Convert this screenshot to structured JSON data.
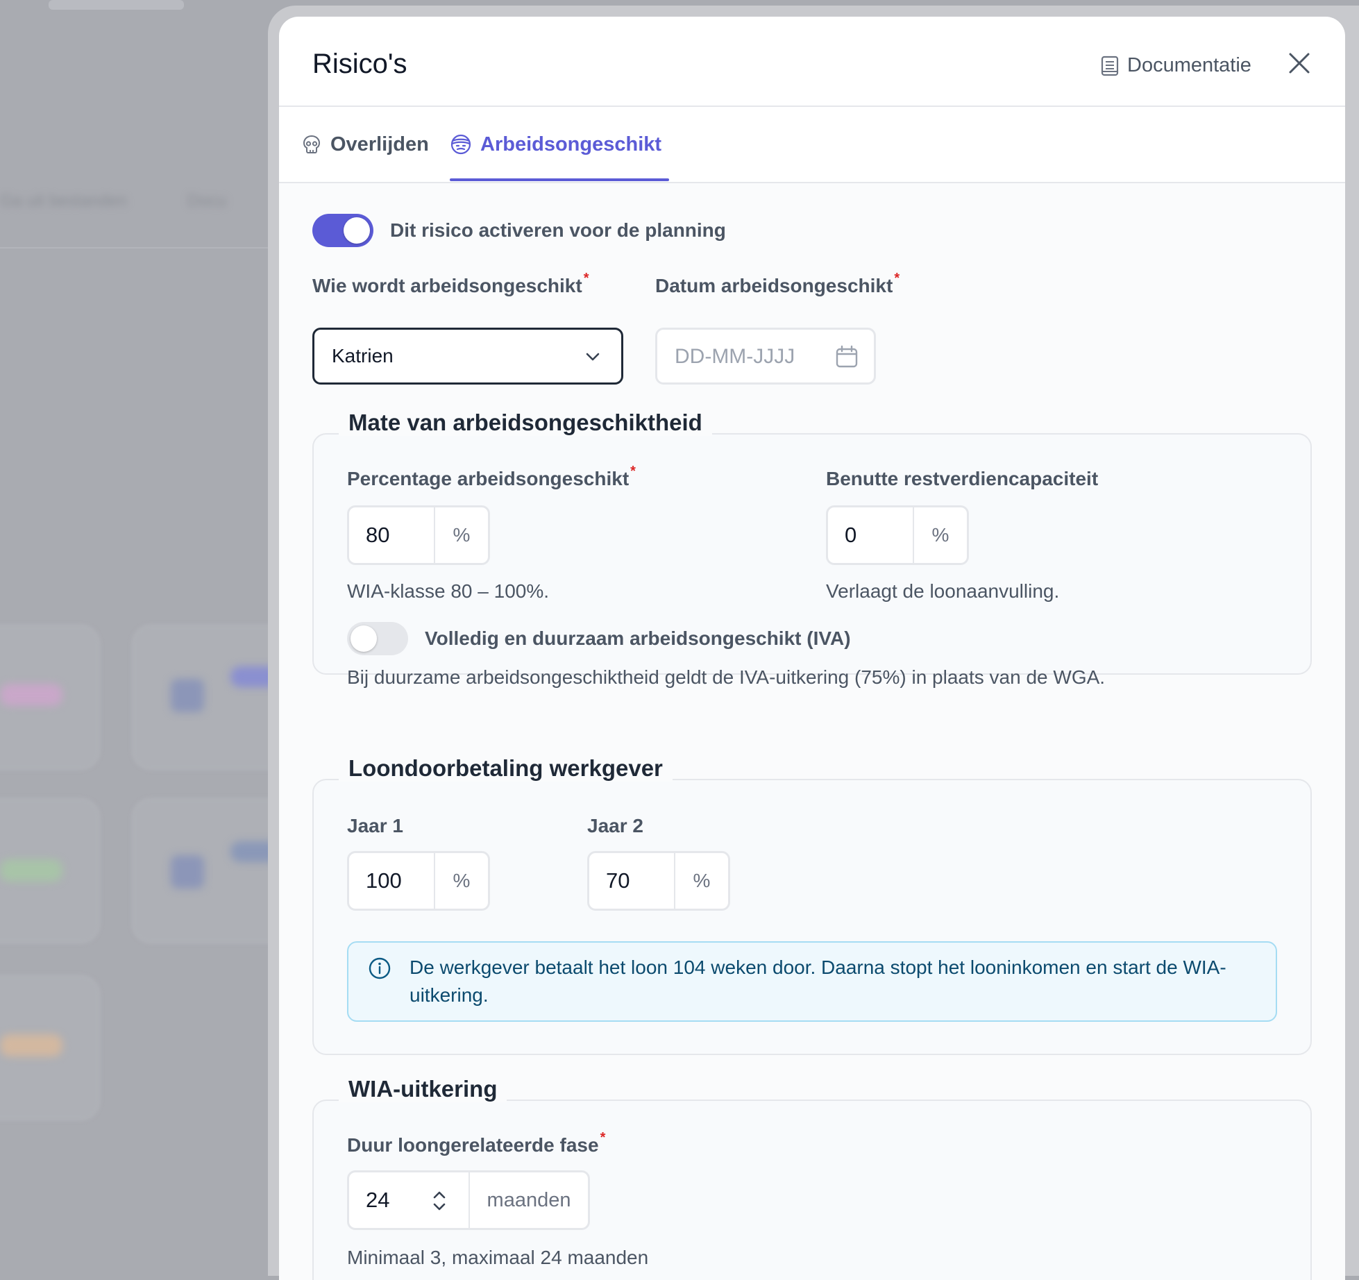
{
  "background": {
    "text_left": "Ga uit bestanden",
    "text_right": "Docu"
  },
  "modal": {
    "title": "Risico's",
    "doc_link": "Documentatie",
    "close_icon": "close-icon"
  },
  "tabs": [
    {
      "label": "Overlijden",
      "icon": "skull-icon",
      "active": false
    },
    {
      "label": "Arbeidsongeschikt",
      "icon": "bandaged-face-icon",
      "active": true
    }
  ],
  "activate": {
    "label": "Dit risico activeren voor de planning",
    "enabled": true
  },
  "who": {
    "label": "Wie wordt arbeidsongeschikt",
    "required_mark": "*",
    "value": "Katrien"
  },
  "date": {
    "label": "Datum arbeidsongeschikt",
    "required_mark": "*",
    "placeholder": "DD-MM-JJJJ"
  },
  "degree": {
    "legend": "Mate van arbeidsongeschiktheid",
    "percentage": {
      "label": "Percentage arbeidsongeschikt",
      "required_mark": "*",
      "value": "80",
      "unit": "%",
      "help": "WIA-klasse 80 – 100%."
    },
    "residual": {
      "label": "Benutte restverdiencapaciteit",
      "value": "0",
      "unit": "%",
      "help": "Verlaagt de loonaanvulling."
    },
    "iva": {
      "label": "Volledig en duurzaam arbeidsongeschikt (IVA)",
      "enabled": false,
      "help": "Bij duurzame arbeidsongeschiktheid geldt de IVA-uitkering (75%) in plaats van de WGA."
    }
  },
  "salary": {
    "legend": "Loondoorbetaling werkgever",
    "year1": {
      "label": "Jaar 1",
      "value": "100",
      "unit": "%"
    },
    "year2": {
      "label": "Jaar 2",
      "value": "70",
      "unit": "%"
    },
    "info": "De werkgever betaalt het loon 104 weken door. Daarna stopt het looninkomen en start de WIA-uitkering."
  },
  "wia": {
    "legend": "WIA-uitkering",
    "duration": {
      "label": "Duur loongerelateerde fase",
      "required_mark": "*",
      "value": "24",
      "unit": "maanden",
      "help": "Minimaal 3, maximaal 24 maanden"
    }
  },
  "colors": {
    "accent": "#5b5bd6",
    "required": "#dc2626",
    "info_bg": "#eef8fd",
    "info_text": "#0b4a6e"
  }
}
